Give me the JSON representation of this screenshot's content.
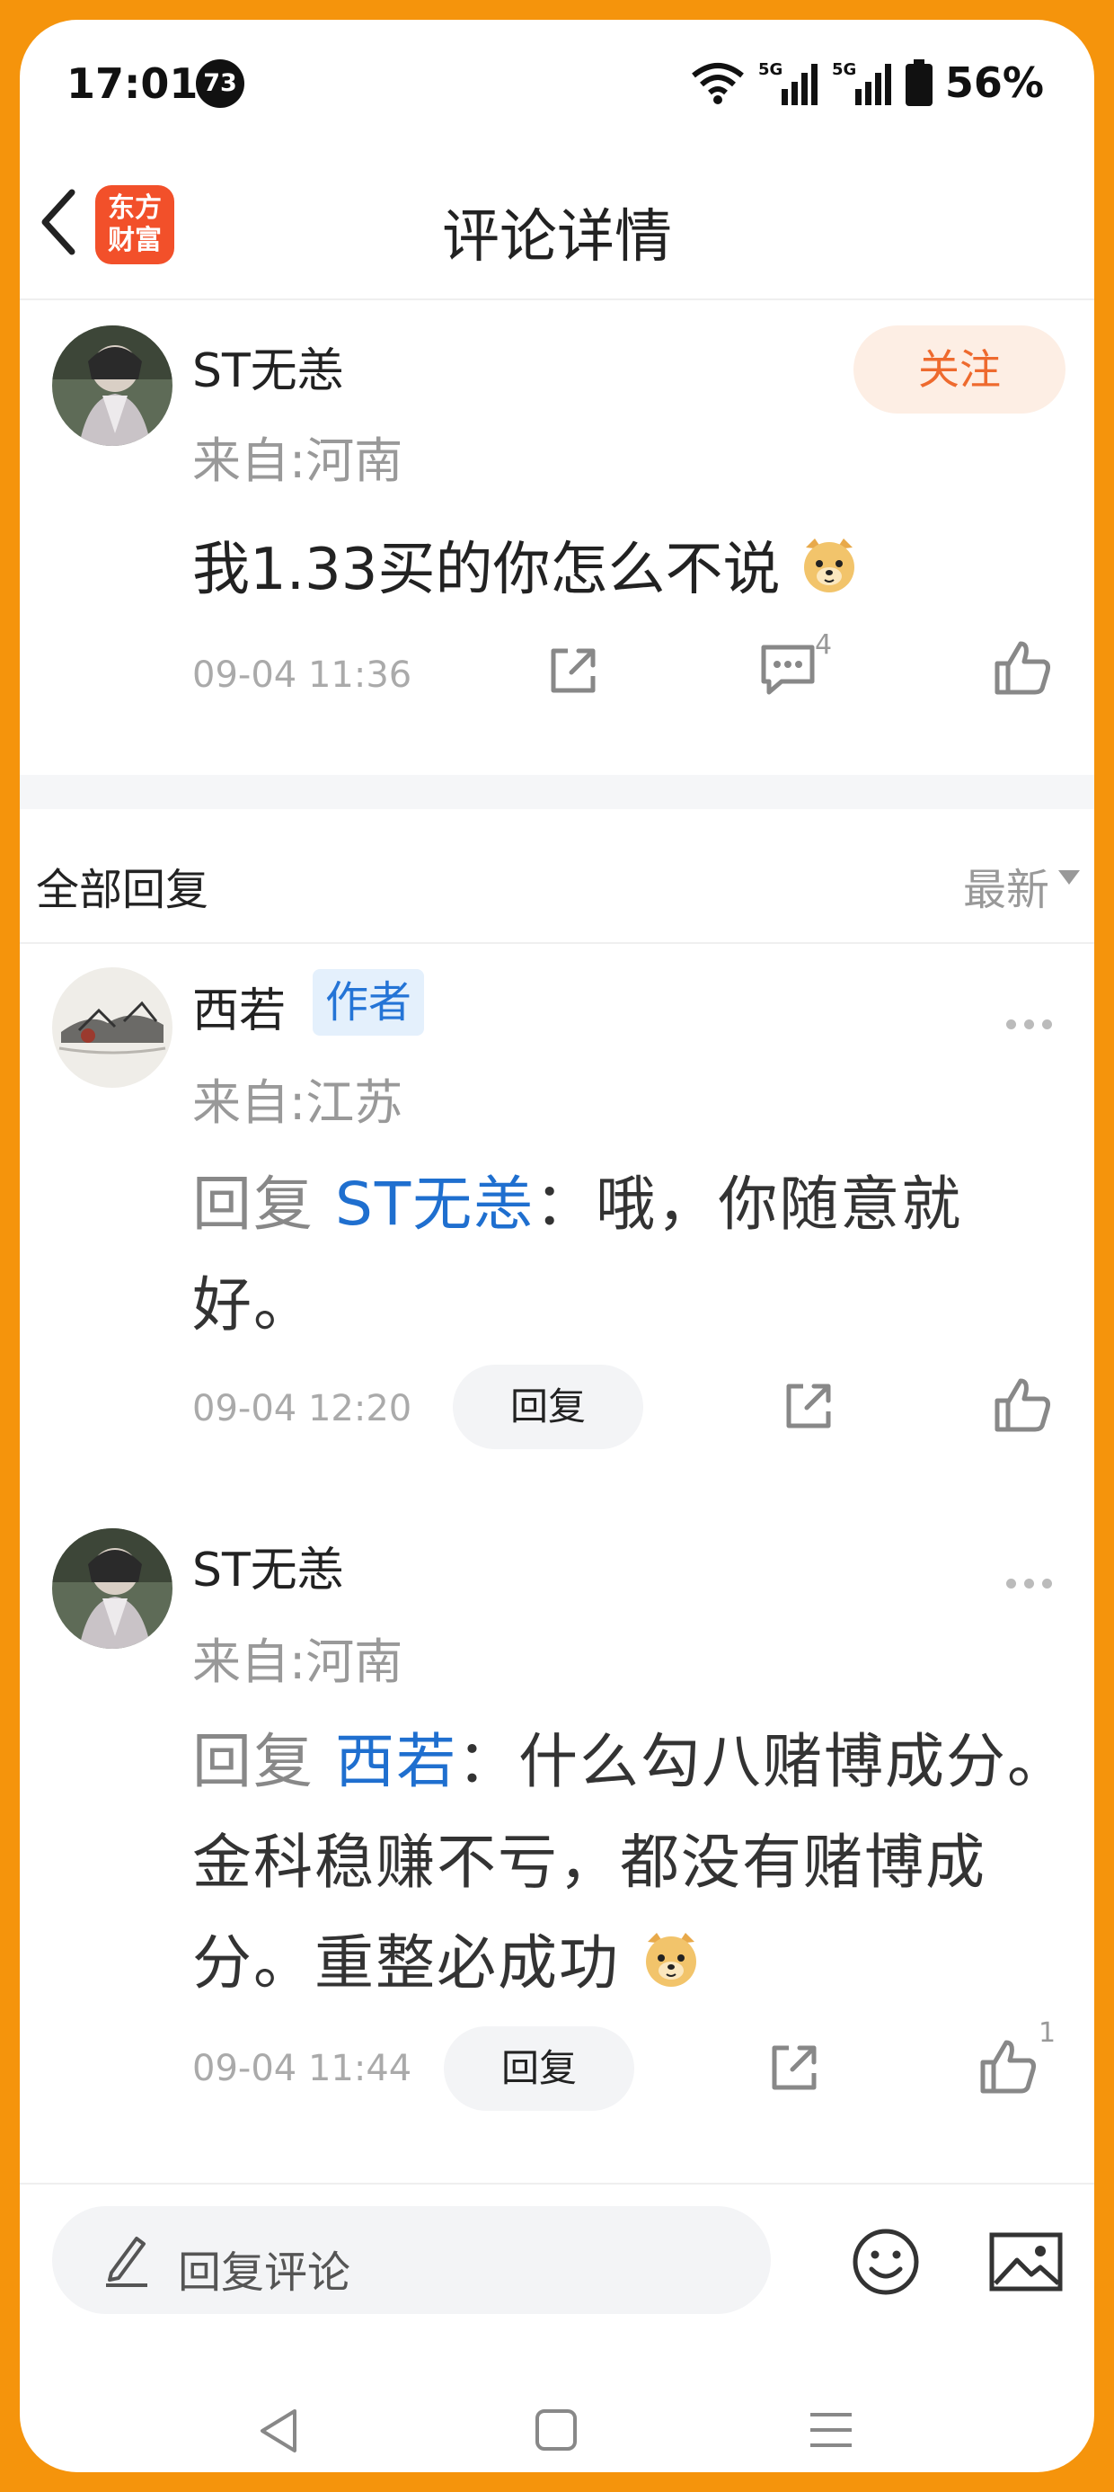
{
  "status_bar": {
    "time": "17:01",
    "notification_count": "73",
    "battery": "56%"
  },
  "header": {
    "title": "评论详情",
    "logo_line1": "东方",
    "logo_line2": "财富"
  },
  "main_comment": {
    "user": "ST无恙",
    "location": "来自:河南",
    "follow_label": "关注",
    "text": "我1.33买的你怎么不说",
    "time": "09-04 11:36",
    "comment_count": "4"
  },
  "replies_header": {
    "label": "全部回复",
    "sort": "最新"
  },
  "replies": [
    {
      "user": "西若",
      "badge": "作者",
      "location": "来自:江苏",
      "prefix": "回复",
      "to": "ST无恙",
      "text": "：哦，你随意就好。",
      "time": "09-04 12:20",
      "reply_label": "回复",
      "likes": ""
    },
    {
      "user": "ST无恙",
      "location": "来自:河南",
      "prefix": "回复",
      "to": "西若",
      "text": "：什么勾八赌博成分。金科稳赚不亏，都没有赌博成分。重整必成功",
      "time": "09-04 11:44",
      "reply_label": "回复",
      "likes": "1"
    }
  ],
  "bottom_bar": {
    "input_placeholder": "回复评论"
  },
  "colors": {
    "accent_orange": "#EE6A2E",
    "link_blue": "#1F6FCF",
    "frame": "#F5940C"
  }
}
